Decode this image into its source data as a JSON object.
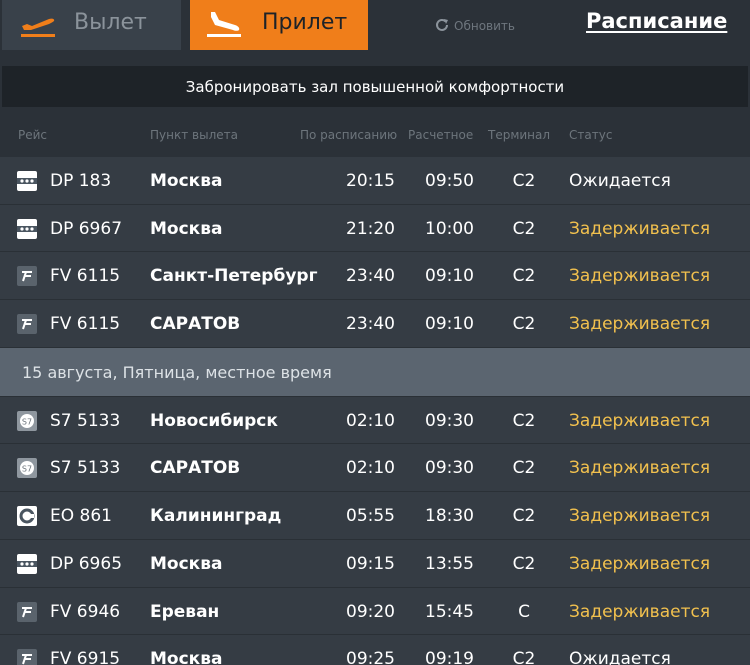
{
  "tabs": {
    "departure_label": "Вылет",
    "arrival_label": "Прилет"
  },
  "refresh_label": "Обновить",
  "schedule_label": "Расписание",
  "booking_label": "Забронировать зал повышенной комфортности",
  "columns": {
    "flight": "Рейс",
    "origin": "Пункт вылета",
    "scheduled": "По расписанию",
    "estimated": "Расчетное",
    "terminal": "Терминал",
    "status": "Статус"
  },
  "group1": [
    {
      "airline": "dp",
      "flight": "DP 183",
      "city": "Москва",
      "scheduled": "20:15",
      "estimated": "09:50",
      "terminal": "C2",
      "status": "Ожидается",
      "status_type": "expected"
    },
    {
      "airline": "dp",
      "flight": "DP 6967",
      "city": "Москва",
      "scheduled": "21:20",
      "estimated": "10:00",
      "terminal": "C2",
      "status": "Задерживается",
      "status_type": "delayed"
    },
    {
      "airline": "fv",
      "flight": "FV 6115",
      "city": "Санкт-Петербург",
      "scheduled": "23:40",
      "estimated": "09:10",
      "terminal": "C2",
      "status": "Задерживается",
      "status_type": "delayed"
    },
    {
      "airline": "fv",
      "flight": "FV 6115",
      "city": "САРАТОВ",
      "scheduled": "23:40",
      "estimated": "09:10",
      "terminal": "C2",
      "status": "Задерживается",
      "status_type": "delayed"
    }
  ],
  "date_separator": "15 августа, Пятница, местное время",
  "group2": [
    {
      "airline": "s7",
      "flight": "S7 5133",
      "city": "Новосибирск",
      "scheduled": "02:10",
      "estimated": "09:30",
      "terminal": "C2",
      "status": "Задерживается",
      "status_type": "delayed"
    },
    {
      "airline": "s7",
      "flight": "S7 5133",
      "city": "САРАТОВ",
      "scheduled": "02:10",
      "estimated": "09:30",
      "terminal": "C2",
      "status": "Задерживается",
      "status_type": "delayed"
    },
    {
      "airline": "eo",
      "flight": "EO 861",
      "city": "Калининград",
      "scheduled": "05:55",
      "estimated": "18:30",
      "terminal": "C2",
      "status": "Задерживается",
      "status_type": "delayed"
    },
    {
      "airline": "dp",
      "flight": "DP 6965",
      "city": "Москва",
      "scheduled": "09:15",
      "estimated": "13:55",
      "terminal": "C2",
      "status": "Задерживается",
      "status_type": "delayed"
    },
    {
      "airline": "fv",
      "flight": "FV 6946",
      "city": "Ереван",
      "scheduled": "09:20",
      "estimated": "15:45",
      "terminal": "C",
      "status": "Задерживается",
      "status_type": "delayed"
    },
    {
      "airline": "fv",
      "flight": "FV 6915",
      "city": "Москва",
      "scheduled": "09:25",
      "estimated": "09:19",
      "terminal": "C2",
      "status": "Ожидается",
      "status_type": "expected"
    }
  ],
  "colors": {
    "accent": "#f07e1a",
    "delayed": "#f2c14e",
    "row_bg": "#353c44",
    "date_bg": "#5b6570"
  }
}
